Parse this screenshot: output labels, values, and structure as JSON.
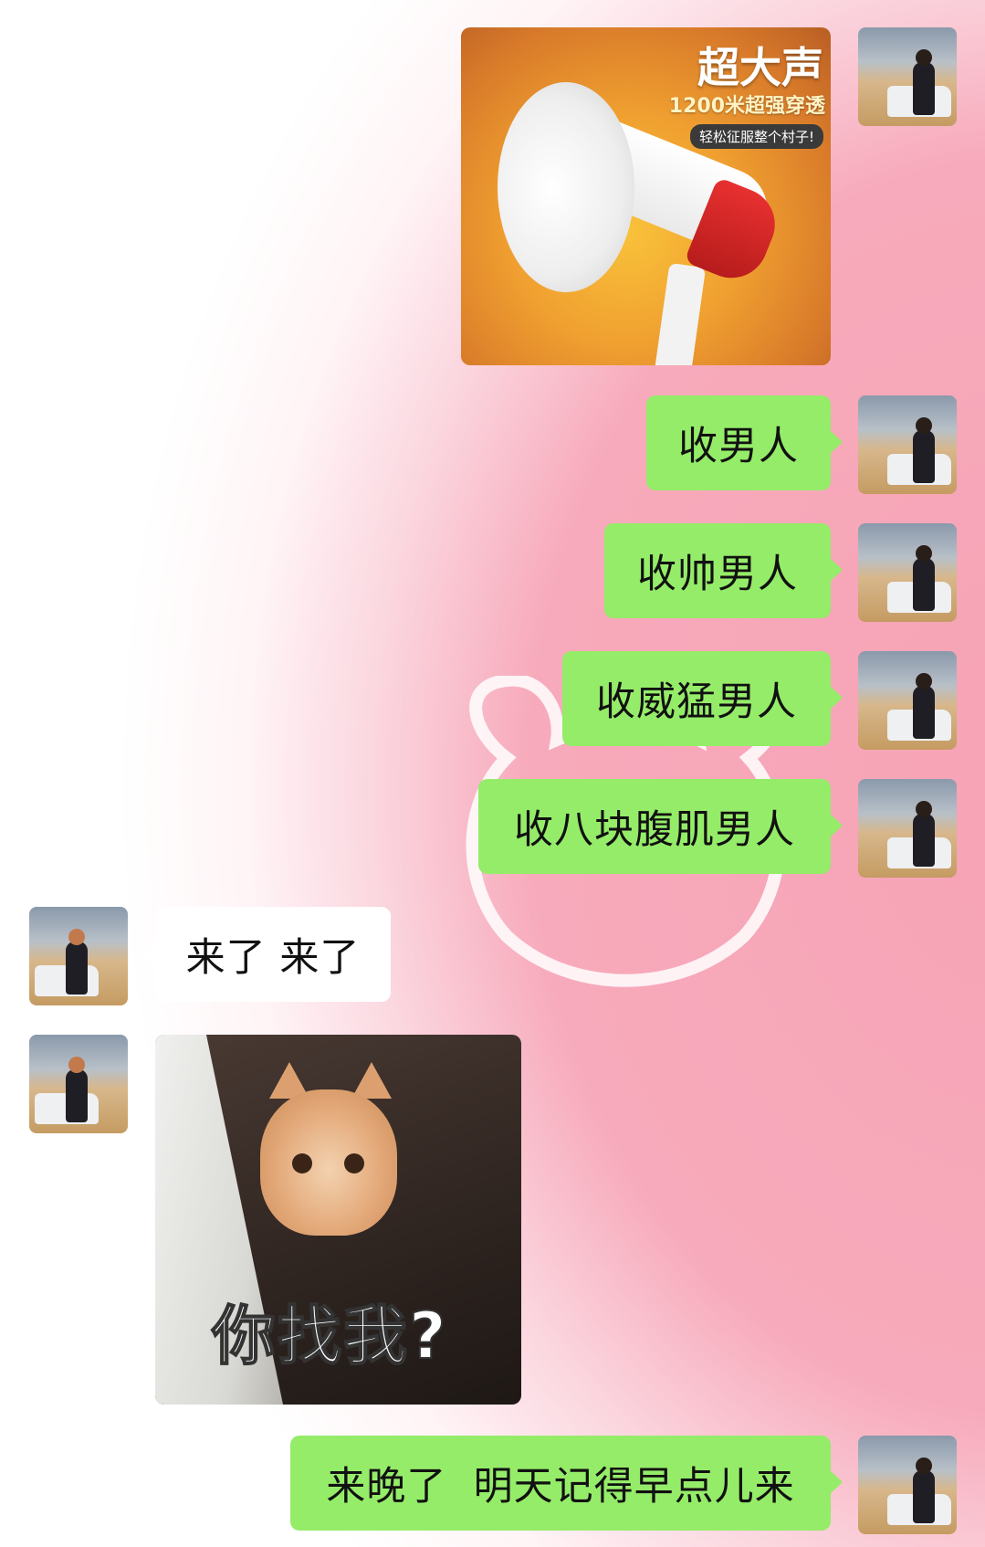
{
  "messages": {
    "product_image": {
      "title": "超大声",
      "subtitle": "1200米超强穿透",
      "tag": "轻松征服整个村子!"
    },
    "sent_1": "收男人",
    "sent_2": "收帅男人",
    "sent_3": "收威猛男人",
    "sent_4": "收八块腹肌男人",
    "received_1": "来了 来了",
    "cat_sticker": {
      "caption": "你找我?"
    },
    "sent_5": "来晚了  明天记得早点儿来"
  },
  "colors": {
    "sent_bubble": "#95ec69",
    "received_bubble": "#ffffff",
    "background_pink": "#f7aabb"
  },
  "icons": {
    "self_avatar": "avatar-icon",
    "contact_avatar": "avatar-icon"
  }
}
